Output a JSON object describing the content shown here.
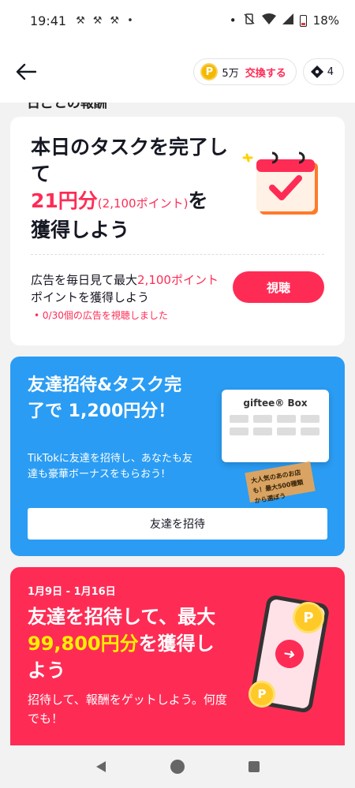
{
  "status_bar": {
    "time": "19:41",
    "battery": "18%"
  },
  "header": {
    "points": "5万",
    "exchange_label": "交換する",
    "tickets": "4",
    "colors": {
      "accent": "#fe2c55",
      "coin": "#f5b800"
    }
  },
  "section_heading": "日ごとの報酬",
  "daily_task": {
    "title_line1": "本日のタスクを完了して",
    "amount": "21円分",
    "amount_sub": "(2,100ポイント)",
    "title_suffix": "を",
    "title_line3": "獲得しよう",
    "ad_text_prefix": "広告を毎日見て最大",
    "ad_text_highlight": "2,100ポイント",
    "ad_text_suffix": "ポイントを獲得しよう",
    "progress": "• 0/30個の広告を視聴しました",
    "watch_button": "視聴"
  },
  "invite_card": {
    "title": "友達招待&タスク完了で 1,200円分！",
    "description": "TikTokに友達を招待し、あなたも友達も豪華ボーナスをもらおう!",
    "giftbox_title": "giftee® Box",
    "tag_text": "大人気のあのお店も！最大500種類から選ぼう",
    "invite_button": "友達を招待",
    "color": "#2a9cf3"
  },
  "campaign_card": {
    "dates": "1月9日 - 1月16日",
    "title_prefix": "友達を招待して、最大",
    "title_amount": "99,800円分",
    "title_suffix": "を獲得しよう",
    "description": "招待して、報酬をゲットしよう。何度でも！",
    "color": "#fe2c55"
  }
}
